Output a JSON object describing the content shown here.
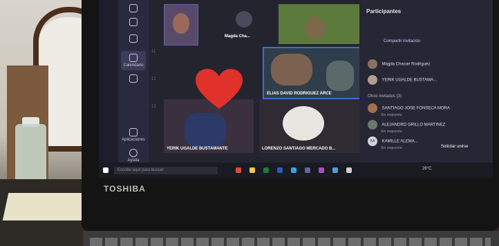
{
  "teams": {
    "rail": [
      {
        "label": "",
        "icon": "activity-icon"
      },
      {
        "label": "",
        "icon": "chat-icon"
      },
      {
        "label": "Calendario",
        "icon": "calendar-icon"
      },
      {
        "label": "",
        "icon": "files-icon"
      },
      {
        "label": "Aplicaciones",
        "icon": "apps-icon"
      },
      {
        "label": "Ayuda",
        "icon": "help-icon"
      }
    ],
    "tiles": {
      "magda_label": "Magda Cha...",
      "elias_label": "ELIAS DAVID RODRIGUEZ ARCE",
      "yerik_label": "YERIK UGALDE BUSTAMANTE",
      "lorenzo_label": "LORENZO SANTIAGO MERCADO B..."
    },
    "panel": {
      "title": "Participantes",
      "share_invite": "Compartir invitación",
      "in_meeting": [
        {
          "name": "Magda Chacon Rodriguez",
          "status": ""
        },
        {
          "name": "YERIK UGALDE BUSTAMA...",
          "status": ""
        }
      ],
      "others_header": "Otros invitados (3)",
      "others": [
        {
          "name": "SANTIAGO JOSE FONSECA MORA",
          "status": "Sin respuesta"
        },
        {
          "name": "ALEJANDRO GRILLO MARTINEZ",
          "status": "Sin respuesta"
        },
        {
          "name": "KAMILLE ALEMA...",
          "status": "Sin respuesta",
          "avatar": "KA"
        }
      ],
      "ask_join": "Solicitar unirse"
    }
  },
  "taskbar": {
    "search_placeholder": "Escribe aquí para buscar",
    "weather": "26°C"
  },
  "laptop": {
    "brand": "TOSHIBA"
  },
  "colors": {
    "accent": "#6264a7",
    "panel": "#262634",
    "heart": "#e0312b"
  }
}
